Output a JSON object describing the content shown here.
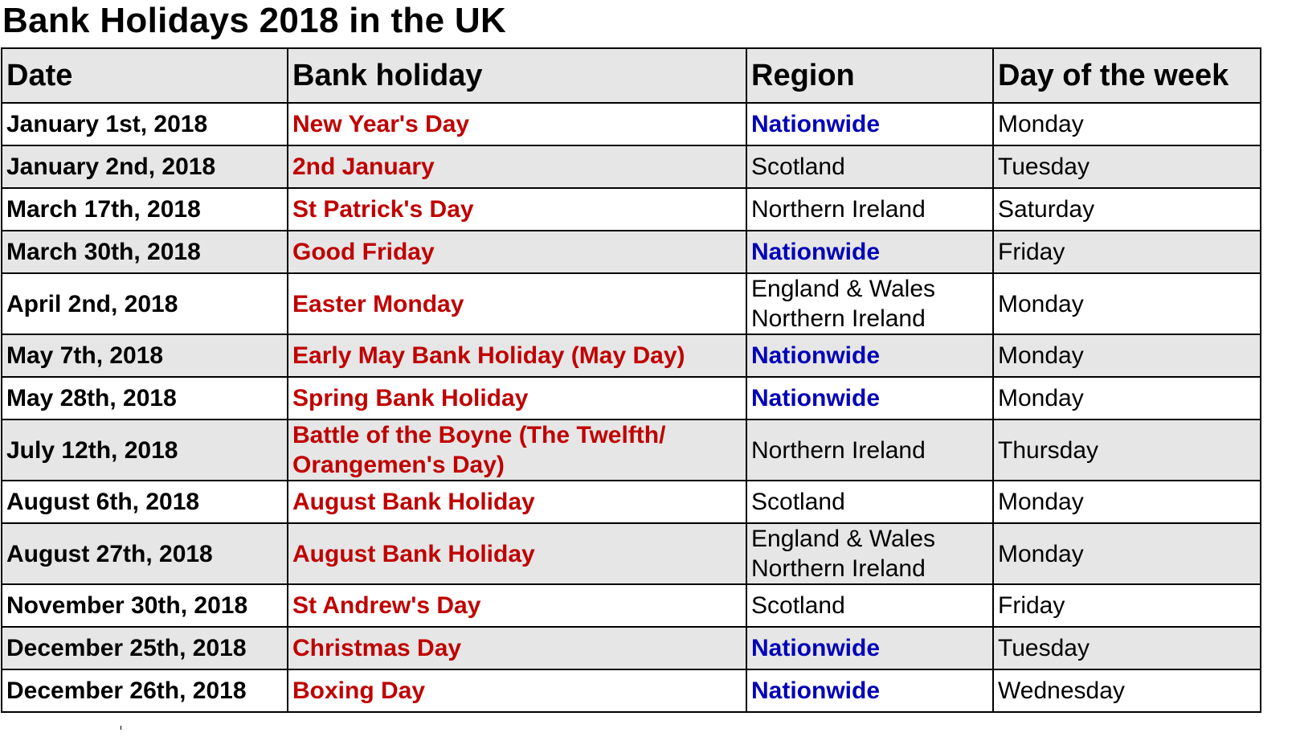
{
  "title": "Bank Holidays 2018 in the UK",
  "colors": {
    "holiday": "#c00000",
    "nationwide": "#0000b8",
    "header_bg": "#e6e6e6",
    "stripe_bg": "#e6e6e6"
  },
  "table": {
    "headers": [
      "Date",
      "Bank holiday",
      "Region",
      "Day of the week"
    ],
    "rows": [
      {
        "date": "January 1st, 2018",
        "holiday": "New Year's Day",
        "region": [
          "Nationwide"
        ],
        "day": "Monday"
      },
      {
        "date": "January 2nd, 2018",
        "holiday": "2nd January",
        "region": [
          "Scotland"
        ],
        "day": "Tuesday"
      },
      {
        "date": "March 17th, 2018",
        "holiday": "St Patrick's Day",
        "region": [
          "Northern Ireland"
        ],
        "day": "Saturday"
      },
      {
        "date": "March 30th, 2018",
        "holiday": "Good Friday",
        "region": [
          "Nationwide"
        ],
        "day": "Friday"
      },
      {
        "date": "April 2nd, 2018",
        "holiday": "Easter Monday",
        "region": [
          "England & Wales",
          "Northern Ireland"
        ],
        "day": "Monday"
      },
      {
        "date": "May 7th, 2018",
        "holiday": "Early May Bank Holiday (May Day)",
        "region": [
          "Nationwide"
        ],
        "day": "Monday"
      },
      {
        "date": "May 28th, 2018",
        "holiday": "Spring Bank Holiday",
        "region": [
          "Nationwide"
        ],
        "day": "Monday"
      },
      {
        "date": "July 12th, 2018",
        "holiday": "Battle of the Boyne (The Twelfth/ Orangemen's Day)",
        "region": [
          "Northern Ireland"
        ],
        "day": "Thursday"
      },
      {
        "date": "August 6th, 2018",
        "holiday": "August Bank Holiday",
        "region": [
          "Scotland"
        ],
        "day": "Monday"
      },
      {
        "date": "August 27th, 2018",
        "holiday": "August Bank Holiday",
        "region": [
          "England & Wales",
          "Northern Ireland"
        ],
        "day": "Monday"
      },
      {
        "date": "November 30th, 2018",
        "holiday": "St Andrew's Day",
        "region": [
          "Scotland"
        ],
        "day": "Friday"
      },
      {
        "date": "December 25th, 2018",
        "holiday": "Christmas Day",
        "region": [
          "Nationwide"
        ],
        "day": "Tuesday"
      },
      {
        "date": "December 26th, 2018",
        "holiday": "Boxing Day",
        "region": [
          "Nationwide"
        ],
        "day": "Wednesday"
      }
    ]
  }
}
